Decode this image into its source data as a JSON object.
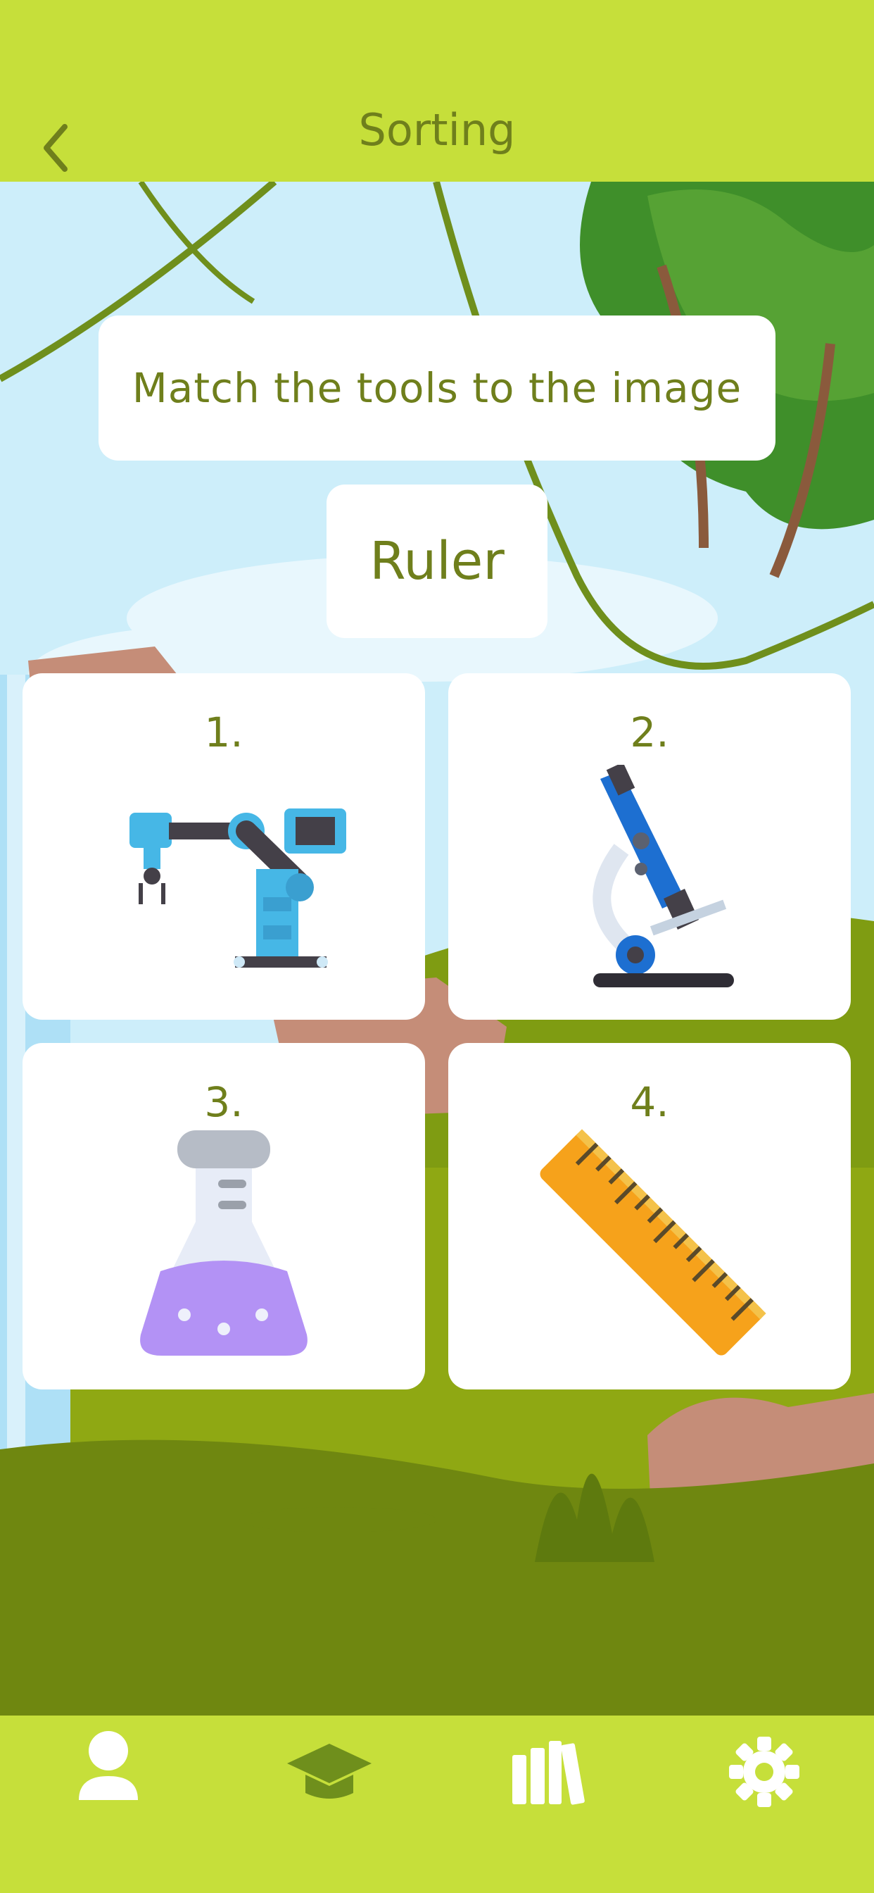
{
  "header": {
    "title": "Sorting"
  },
  "prompt": {
    "text": "Match the tools to the image"
  },
  "target_word": "Ruler",
  "options": [
    {
      "number": "1.",
      "icon": "robot-arm-icon"
    },
    {
      "number": "2.",
      "icon": "microscope-icon"
    },
    {
      "number": "3.",
      "icon": "flask-icon"
    },
    {
      "number": "4.",
      "icon": "ruler-icon"
    }
  ],
  "nav": {
    "items": [
      "profile-icon",
      "graduation-cap-icon",
      "library-icon",
      "settings-icon"
    ]
  },
  "colors": {
    "accent": "#c6df3a",
    "text": "#6f7f1c",
    "card": "#ffffff"
  }
}
